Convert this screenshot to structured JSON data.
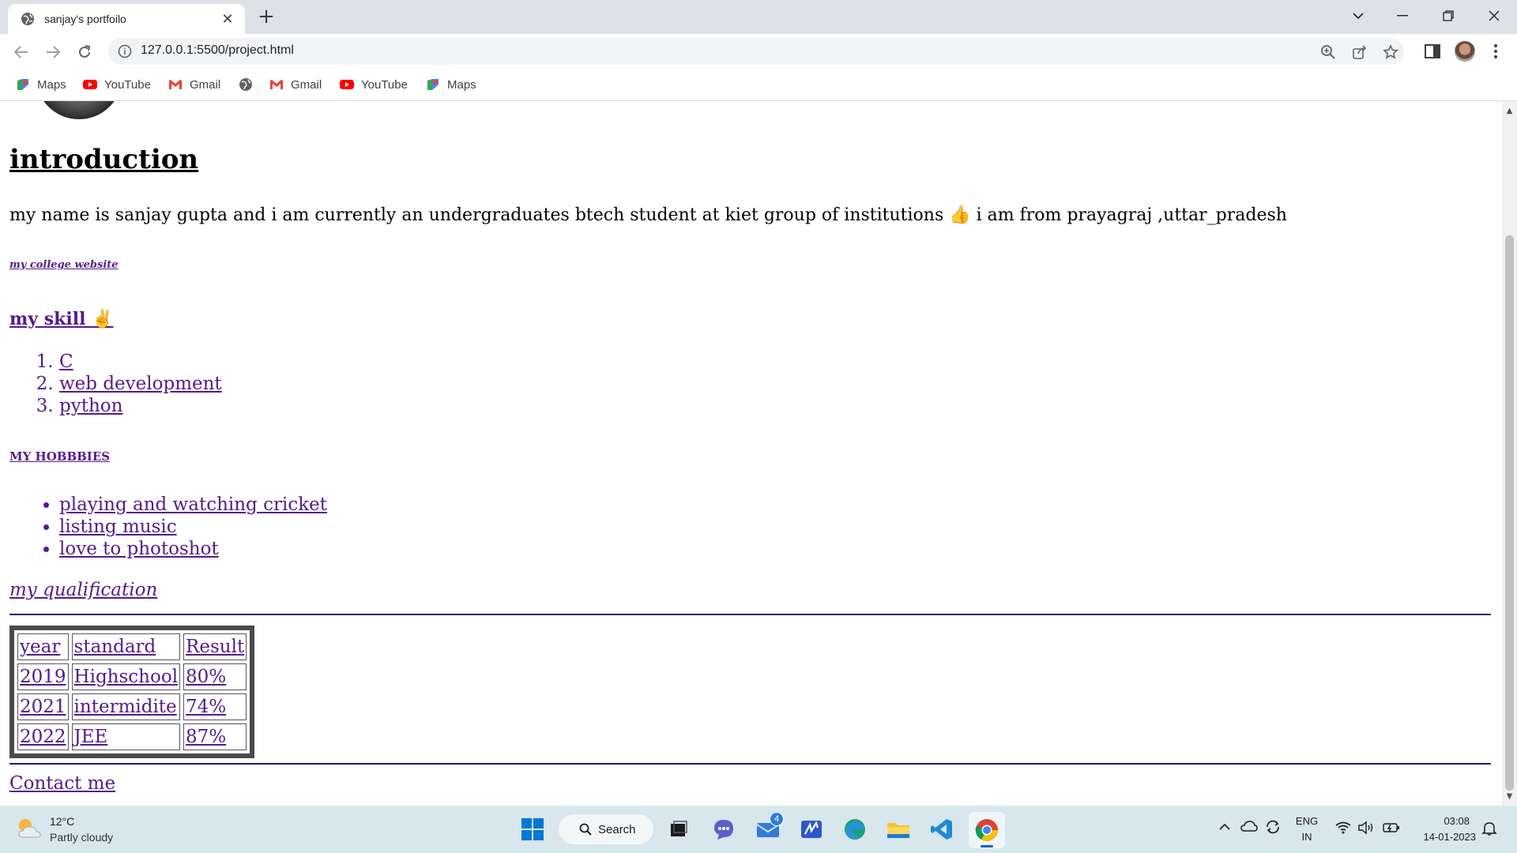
{
  "browser": {
    "tab_title": "sanjay's portfoilo",
    "new_tab_symbol": "+",
    "url": "127.0.0.1:5500/project.html",
    "bookmarks": [
      {
        "label": "Maps",
        "icon": "maps-icon"
      },
      {
        "label": "YouTube",
        "icon": "youtube-icon"
      },
      {
        "label": "Gmail",
        "icon": "gmail-icon"
      },
      {
        "label": "",
        "icon": "globe-icon"
      },
      {
        "label": "Gmail",
        "icon": "gmail-icon"
      },
      {
        "label": "YouTube",
        "icon": "youtube-icon"
      },
      {
        "label": "Maps",
        "icon": "maps-icon"
      }
    ]
  },
  "page": {
    "intro_heading": "introduction",
    "intro_text": "my name is sanjay gupta and i am currently an undergraduates btech student at kiet group of institutions 👍  i am from prayagraj ,uttar_pradesh",
    "college_link": "my college website",
    "skills_heading": "my skill ✌️ ",
    "skills": [
      "C",
      "web development",
      "python"
    ],
    "hobbies_heading": "MY HOBBBIES",
    "hobbies": [
      "playing and watching cricket",
      "listing music",
      "love to photoshot"
    ],
    "qualification_link": "my qualification",
    "table": {
      "headers": [
        "year",
        "standard",
        "Result"
      ],
      "rows": [
        [
          "2019",
          "Highschool",
          "80%"
        ],
        [
          "2021",
          "intermidite",
          "74%"
        ],
        [
          "2022",
          "JEE",
          "87%"
        ]
      ]
    },
    "contact_link": "Contact me"
  },
  "taskbar": {
    "weather_temp": "12°C",
    "weather_desc": "Partly cloudy",
    "search_label": "Search",
    "mail_badge": "4",
    "lang_top": "ENG",
    "lang_bottom": "IN",
    "time": "03:08",
    "date": "14-01-2023"
  },
  "colors": {
    "visited_link": "#551a8b",
    "taskbar_bg": "#d8e6ee",
    "tabstrip_bg": "#dee1e6"
  }
}
